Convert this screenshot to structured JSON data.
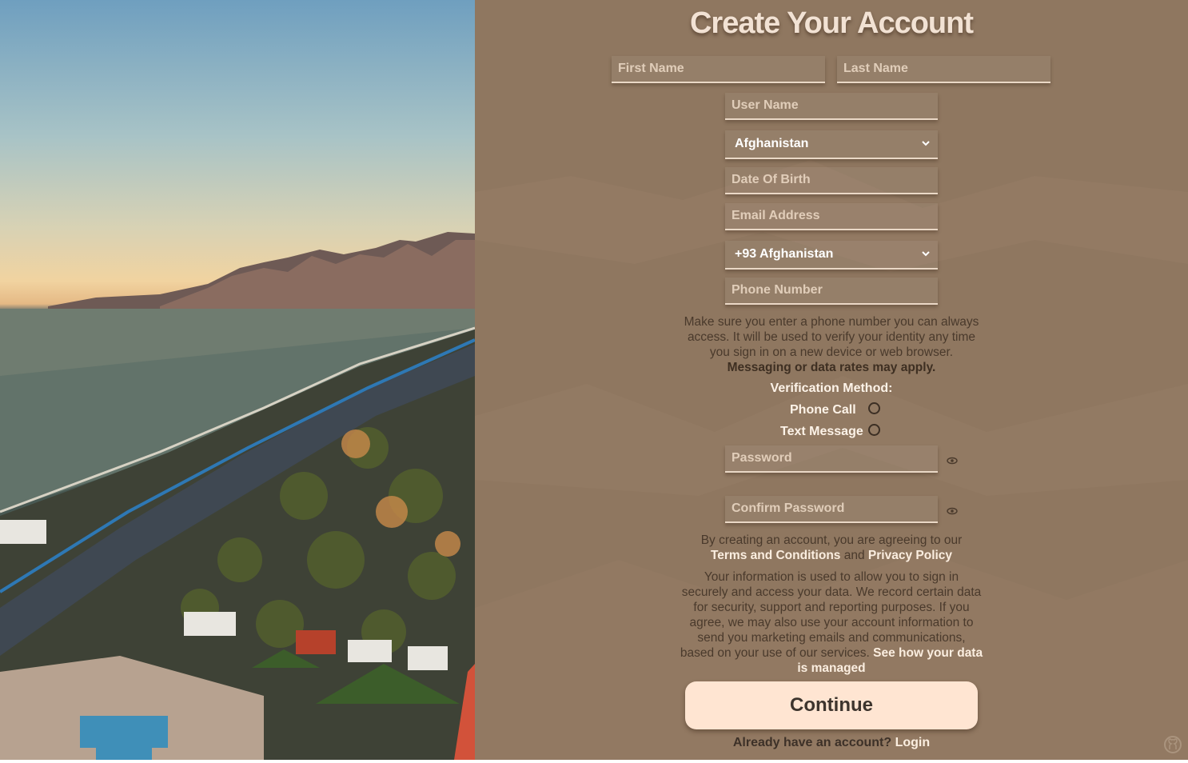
{
  "form": {
    "title": "Create Your Account",
    "first_name_placeholder": "First Name",
    "last_name_placeholder": "Last Name",
    "username_placeholder": "User Name",
    "country_selected": "Afghanistan",
    "dob_placeholder": "Date Of Birth",
    "email_placeholder": "Email Address",
    "phone_code_selected": "+93 Afghanistan",
    "phone_placeholder": "Phone Number",
    "phone_note": "Make sure you enter a phone number you can always access. It will be used to verify your identity any time you sign in on a new device or web browser.",
    "phone_note_bold": "Messaging or data rates may apply.",
    "verification_title": "Verification Method:",
    "verification_options": [
      "Phone Call",
      "Text Message"
    ],
    "password_placeholder": "Password",
    "confirm_password_placeholder": "Confirm Password",
    "terms_prefix": "By creating an account, you are agreeing to our",
    "terms_link": "Terms and Conditions",
    "terms_and": "and",
    "privacy_link": "Privacy Policy",
    "data_note": "Your information is used to allow you to sign in securely and access your data. We record certain data for security, support and reporting purposes. If you agree, we may also use your account information to send you marketing emails and communications, based on your use of our services.",
    "data_link": "See how your data is managed",
    "continue_label": "Continue",
    "login_prompt": "Already have an account?",
    "login_link": "Login"
  },
  "icons": {
    "password_toggle": "eye-icon",
    "confirm_password_toggle": "eye-icon",
    "select_arrow": "chevron-down-icon",
    "footer": "github-icon"
  },
  "colors": {
    "panel_bg": "#8f7760",
    "button_bg": "#ffe5d2",
    "link": "#fbeee0"
  }
}
